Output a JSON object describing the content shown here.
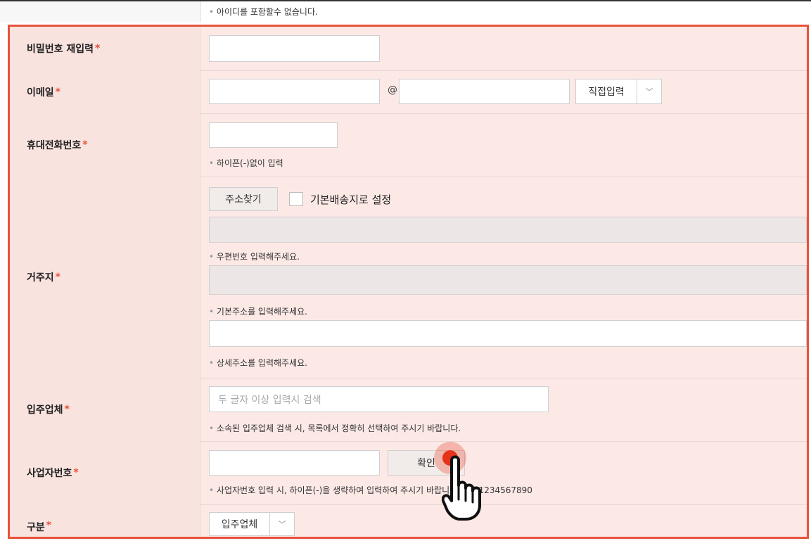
{
  "top_note": "아이디를 포함할수 없습니다.",
  "rows": {
    "password_confirm": {
      "label": "비밀번호 재입력",
      "required_mark": "*"
    },
    "email": {
      "label": "이메일",
      "required_mark": "*",
      "at": "@",
      "domain_select": "직접입력"
    },
    "mobile": {
      "label": "휴대전화번호",
      "required_mark": "*",
      "help": "하이픈(-)없이 입력"
    },
    "address": {
      "label": "거주지",
      "required_mark": "*",
      "search_button": "주소찾기",
      "default_checkbox_label": "기본배송지로 설정",
      "help_zip": "우편번호 입력해주세요.",
      "help_base": "기본주소를 입력해주세요.",
      "help_detail": "상세주소를 입력해주세요."
    },
    "company": {
      "label": "입주업체",
      "required_mark": "*",
      "placeholder": "두 글자 이상 입력시 검색",
      "help": "소속된 입주업체 검색 시, 목록에서 정확히 선택하여 주시기 바랍니다."
    },
    "business_no": {
      "label": "사업자번호",
      "required_mark": "*",
      "confirm_button": "확인",
      "help": "사업자번호 입력 시, 하이픈(-)을 생략하여 입력하여 주시기 바랍니다.  ex) 1234567890"
    },
    "category": {
      "label": "구분",
      "required_mark": "*",
      "select_value": "입주업체"
    }
  },
  "colors": {
    "accent": "#e8533b",
    "form_bg": "#fce9e6"
  },
  "icons": {
    "cursor": "hand-pointer-icon",
    "dropdown": "chevron-down-icon"
  }
}
